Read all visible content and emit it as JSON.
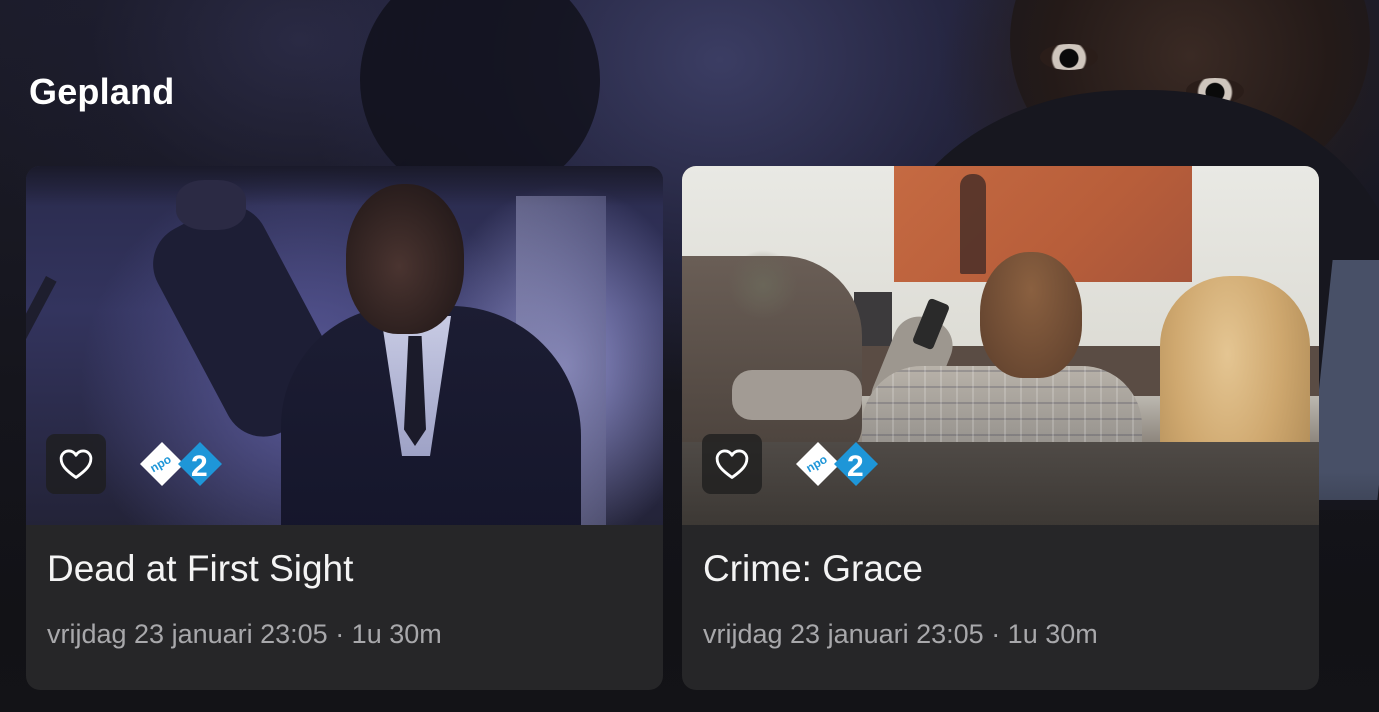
{
  "section": {
    "title": "Gepland"
  },
  "cards": [
    {
      "title": "Dead at First Sight",
      "meta": "vrijdag 23 januari 23:05 · 1u 30m",
      "channel": "npo 2",
      "favorite_icon": "heart-outline-icon"
    },
    {
      "title": "Crime: Grace",
      "meta": "vrijdag 23 januari 23:05 · 1u 30m",
      "channel": "npo 2",
      "favorite_icon": "heart-outline-icon"
    }
  ],
  "colors": {
    "background": "#141418",
    "card": "#262628",
    "title_text": "#f4f4f4",
    "meta_text": "#a8a8ab",
    "npo_blue": "#1e96d8",
    "npo_white": "#ffffff"
  }
}
